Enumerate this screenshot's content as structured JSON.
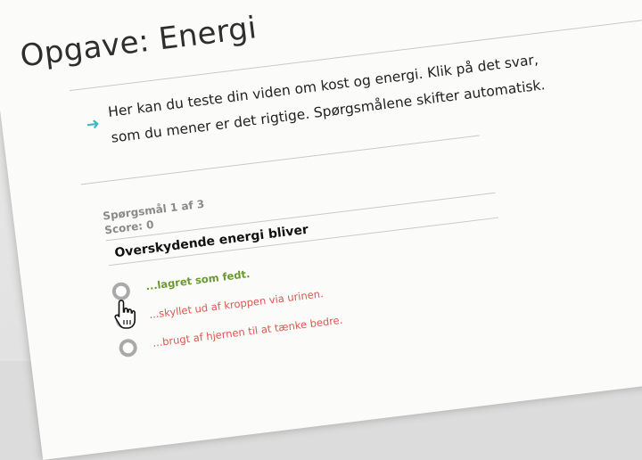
{
  "page": {
    "title": "Opgave: Energi"
  },
  "intro": {
    "arrow_icon": "arrow-right-icon",
    "text": "Her kan du teste din viden om kost og energi. Klik på det svar, som du mener er det rigtige. Spørgsmålene skifter automatisk."
  },
  "quiz": {
    "counter": "Spørgsmål 1 af 3",
    "score": "Score: 0",
    "question": "Overskydende energi bliver",
    "answers": [
      {
        "label": "...lagret som fedt.",
        "state": "correct"
      },
      {
        "label": "...skyllet ud af kroppen via urinen.",
        "state": "wrong"
      },
      {
        "label": "...brugt af hjernen til at tænke bedre.",
        "state": "wrong"
      }
    ]
  },
  "cursor": {
    "icon": "hand-pointer-icon"
  },
  "colors": {
    "accent": "#3fb8c4",
    "correct": "#6a9a2f",
    "wrong": "#e0564e",
    "radio": "#a9a9a9"
  }
}
